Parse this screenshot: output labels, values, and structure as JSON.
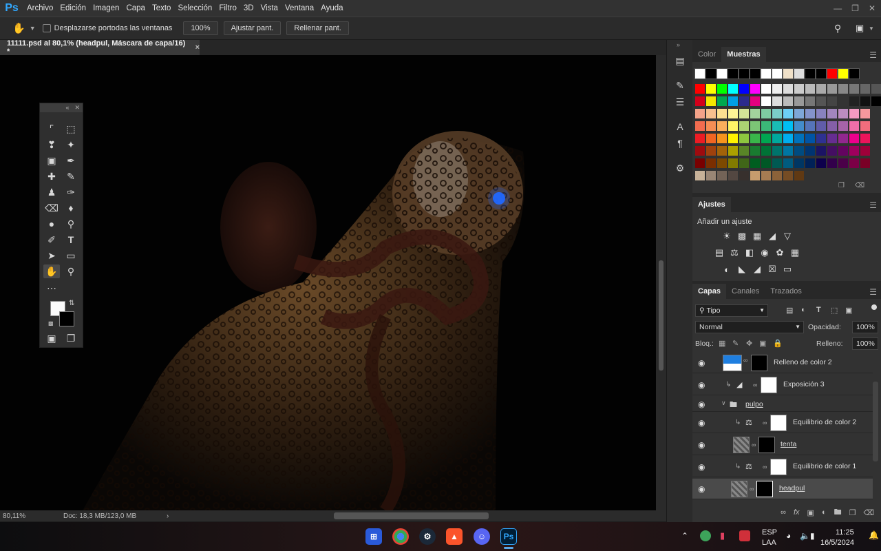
{
  "app": {
    "logo": "Ps",
    "menu": [
      "Archivo",
      "Edición",
      "Imagen",
      "Capa",
      "Texto",
      "Selección",
      "Filtro",
      "3D",
      "Vista",
      "Ventana",
      "Ayuda"
    ]
  },
  "options": {
    "scroll_all_label": "Desplazarse portodas las ventanas",
    "zoom_value": "100%",
    "fit_label": "Ajustar pant.",
    "fill_label": "Rellenar pant."
  },
  "document": {
    "tab_title": "11111.psd al 80,1% (headpul, Máscara de capa/16) *",
    "close": "×"
  },
  "status": {
    "zoom": "80,11%",
    "doc_info": "Doc: 18,3 MB/123,0 MB",
    "arrow": "›"
  },
  "panels": {
    "color_tabs": [
      "Color",
      "Muestras"
    ],
    "adjustments_tab": "Ajustes",
    "add_adjustment": "Añadir un ajuste",
    "layers_tabs": [
      "Capas",
      "Canales",
      "Trazados"
    ],
    "filter_kind": "Tipo",
    "blend_mode": "Normal",
    "opacity_label": "Opacidad:",
    "opacity_value": "100%",
    "lock_label": "Bloq.:",
    "fill_label": "Relleno:",
    "fill_value": "100%"
  },
  "layers": [
    {
      "name": "Relleno de color 2",
      "underline": false
    },
    {
      "name": "Exposición 3",
      "underline": false
    },
    {
      "name": "pulpo",
      "underline": true
    },
    {
      "name": "Equilibrio de color 2",
      "underline": false
    },
    {
      "name": "tenta",
      "underline": true
    },
    {
      "name": "Equilibrio de color 1",
      "underline": false
    },
    {
      "name": "headpul",
      "underline": true
    }
  ],
  "tray": {
    "lang_top": "ESP",
    "lang_bottom": "LAA",
    "time": "11:25",
    "date": "16/5/2024"
  },
  "colors": {
    "accent": "#31a8ff",
    "selected_row": "#4a4a4a"
  }
}
